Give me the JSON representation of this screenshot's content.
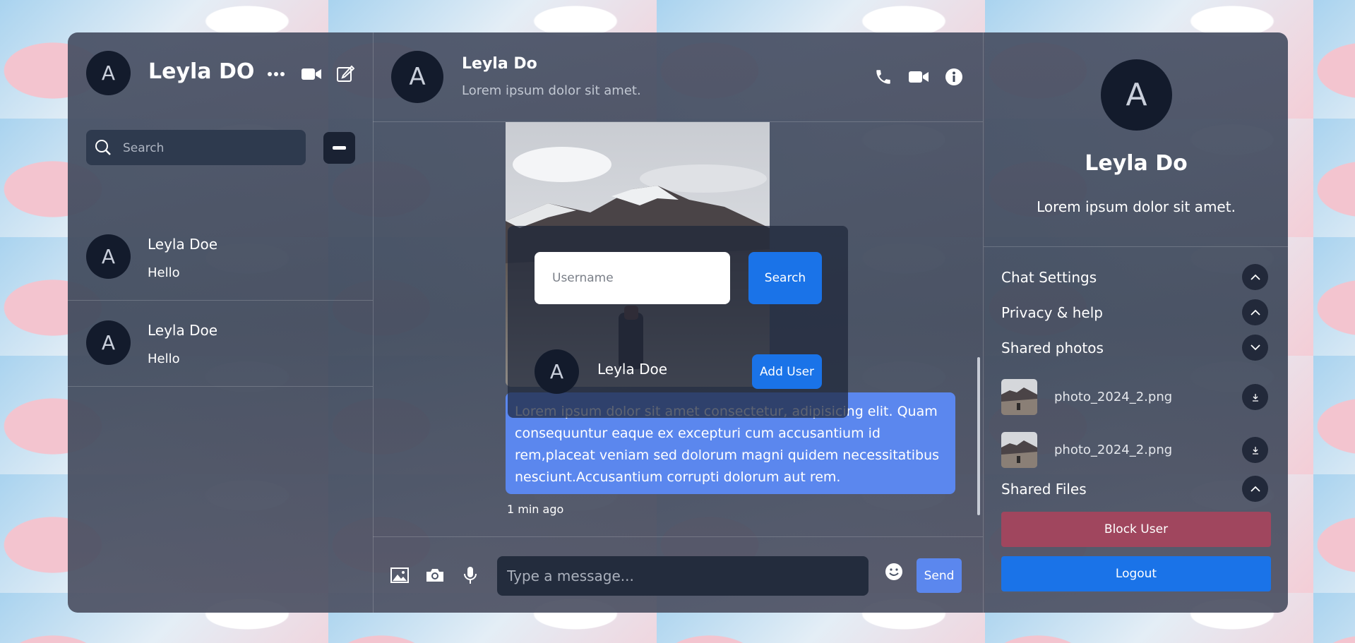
{
  "sidebar": {
    "avatar_letter": "A",
    "user_name": "Leyla DO",
    "search_placeholder": "Search",
    "contacts": [
      {
        "avatar_letter": "A",
        "name": "Leyla Doe",
        "last_message": "Hello"
      },
      {
        "avatar_letter": "A",
        "name": "Leyla Doe",
        "last_message": "Hello"
      }
    ]
  },
  "chat": {
    "header": {
      "avatar_letter": "A",
      "name": "Leyla Do",
      "status": "Lorem ipsum dolor sit amet."
    },
    "message": {
      "text": "Lorem ipsum dolor sit amet consectetur, adipisicing elit. Quam consequuntur eaque ex excepturi cum accusantium id rem,placeat veniam sed dolorum magni quidem necessitatibus nesciunt.Accusantium corrupti dolorum aut rem.",
      "time": "1 min ago"
    },
    "composer": {
      "placeholder": "Type a message...",
      "send_label": "Send"
    }
  },
  "add_user_popup": {
    "username_placeholder": "Username",
    "search_label": "Search",
    "result": {
      "avatar_letter": "A",
      "name": "Leyla Doe",
      "add_label": "Add User"
    }
  },
  "profile": {
    "avatar_letter": "A",
    "name": "Leyla Do",
    "status": "Lorem ipsum dolor sit amet.",
    "sections": {
      "chat_settings": "Chat Settings",
      "privacy_help": "Privacy & help",
      "shared_photos": "Shared photos",
      "shared_files": "Shared Files"
    },
    "photos": [
      {
        "file_name": "photo_2024_2.png"
      },
      {
        "file_name": "photo_2024_2.png"
      }
    ],
    "block_label": "Block User",
    "logout_label": "Logout"
  },
  "colors": {
    "accent": "#1a73e8",
    "bubble": "#5b87ee",
    "block": "#a0465e"
  }
}
